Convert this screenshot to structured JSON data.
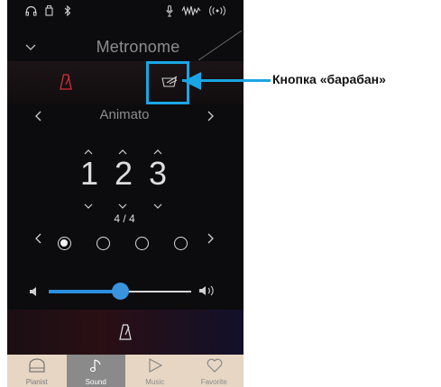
{
  "status_bar": {
    "icons": [
      "headphones-icon",
      "usb-icon",
      "bluetooth-icon",
      "mic-icon",
      "audio-wave-icon",
      "wireless-icon"
    ]
  },
  "header": {
    "title": "Metronome"
  },
  "mode_buttons": {
    "metronome_icon": "metronome-icon",
    "drum_icon": "drum-icon",
    "active": "metronome",
    "accent_color": "#d0303a"
  },
  "rhythm": {
    "name": "Animato"
  },
  "tempo": {
    "digits": [
      "1",
      "2",
      "3"
    ],
    "time_signature": "4 / 4"
  },
  "beats": {
    "count": 4,
    "active_index": 0
  },
  "volume": {
    "level": 0.5,
    "accent_color": "#2c8ee0"
  },
  "bottom_nav": {
    "items": [
      {
        "label": "Pianist",
        "icon": "piano-icon"
      },
      {
        "label": "Sound",
        "icon": "note-icon"
      },
      {
        "label": "Music",
        "icon": "play-icon"
      },
      {
        "label": "Favorite",
        "icon": "heart-icon"
      }
    ],
    "active_index": 1,
    "background": "#e6d6c3"
  },
  "annotation": {
    "text": "Кнопка «барабан»",
    "color": "#1aa6e6"
  }
}
